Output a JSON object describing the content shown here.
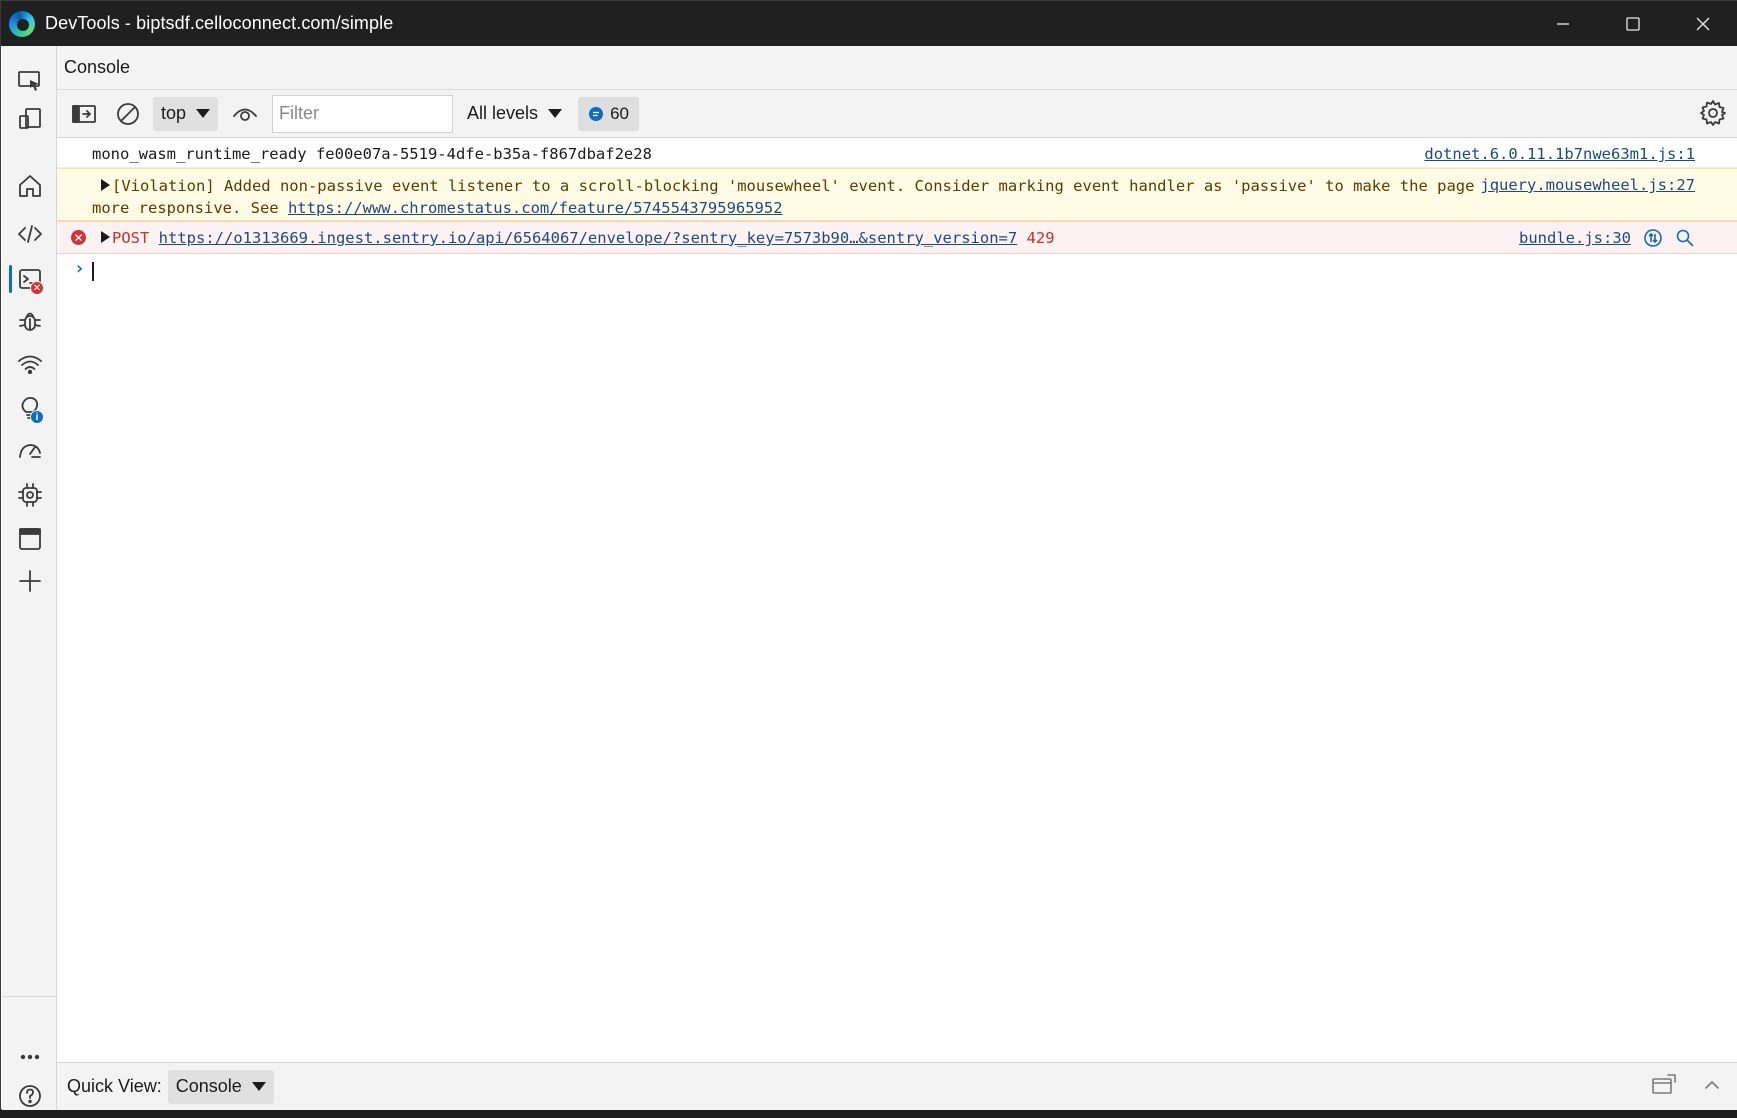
{
  "window": {
    "title": "DevTools - biptsdf.celloconnect.com/simple"
  },
  "panel": {
    "title": "Console"
  },
  "toolbar": {
    "context": "top",
    "filter_placeholder": "Filter",
    "levels": "All levels",
    "message_count": "60"
  },
  "console": {
    "info": {
      "text": "mono_wasm_runtime_ready fe00e07a-5519-4dfe-b35a-f867dbaf2e28",
      "source": "dotnet.6.0.11.1b7nwe63m1.js:1"
    },
    "warning": {
      "text": "[Violation] Added non-passive event listener to a scroll-blocking 'mousewheel' event. Consider marking event handler as 'passive' to make the page more responsive. See ",
      "link": "https://www.chromestatus.com/feature/5745543795965952",
      "source": "jquery.mousewheel.js:27"
    },
    "error": {
      "method": "POST",
      "url": "https://o1313669.ingest.sentry.io/api/6564067/envelope/?sentry_key=7573b90…&sentry_version=7",
      "status": "429",
      "source": "bundle.js:30"
    }
  },
  "quick_view": {
    "label": "Quick View:",
    "selected": "Console"
  },
  "colors": {
    "accent": "#0f6cbd",
    "error": "#d13438",
    "warning_bg": "#fffbe5",
    "error_bg": "#fdf2f2"
  }
}
